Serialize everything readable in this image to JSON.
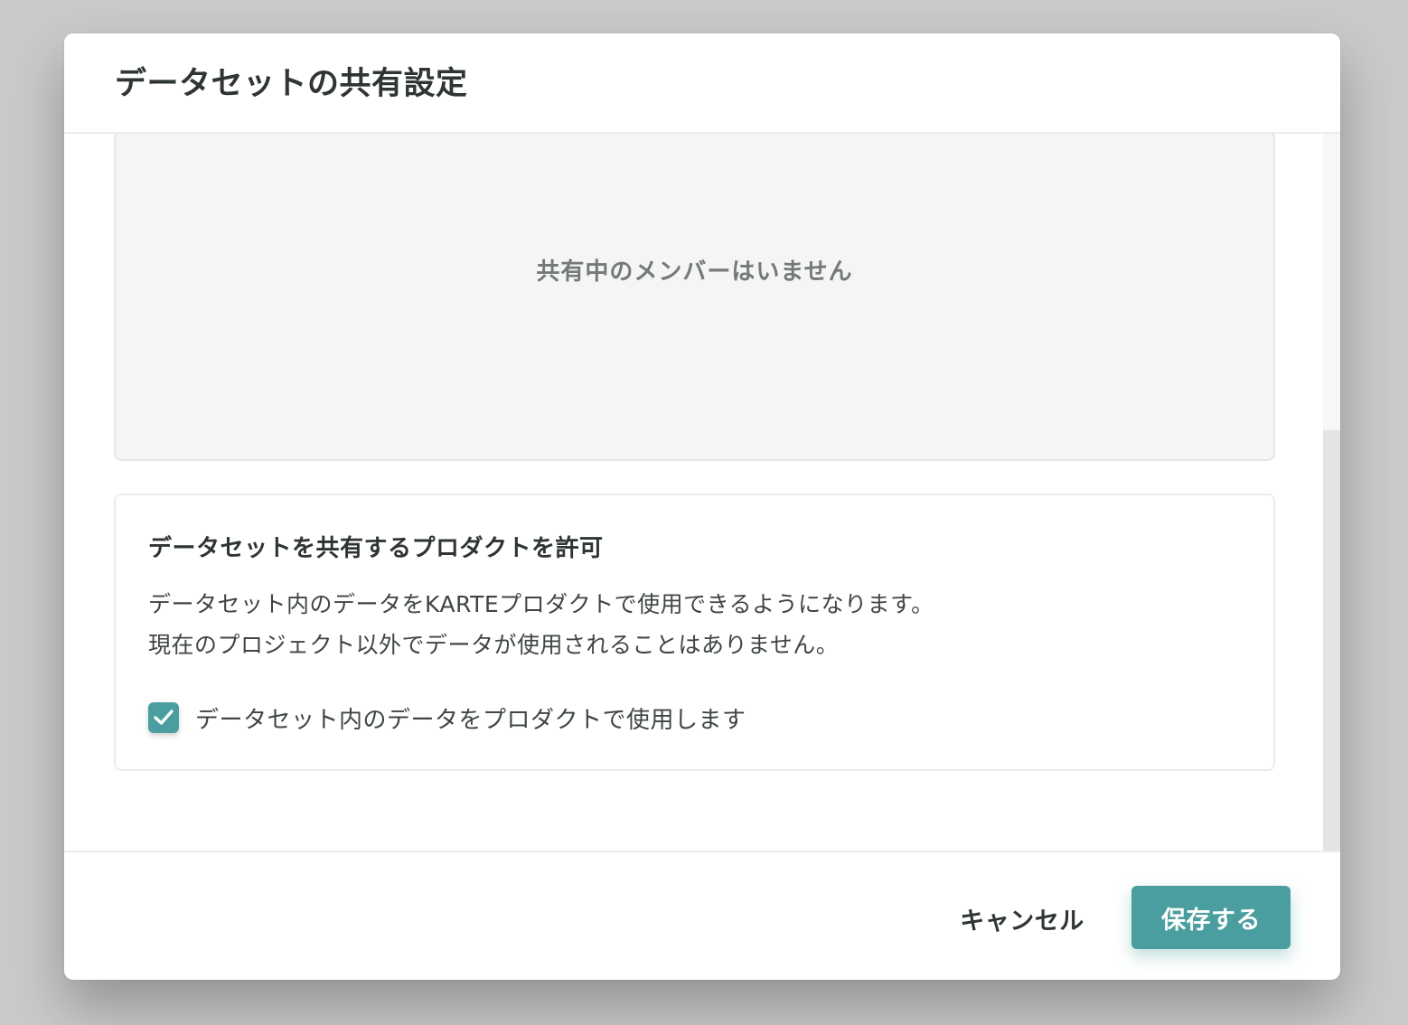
{
  "modal": {
    "title": "データセットの共有設定"
  },
  "members": {
    "empty_text": "共有中のメンバーはいません"
  },
  "permit": {
    "title": "データセットを共有するプロダクトを許可",
    "description_lines": [
      "データセット内のデータをKARTEプロダクトで使用できるようになります。",
      "現在のプロジェクト以外でデータが使用されることはありません。"
    ],
    "checkbox_label": "データセット内のデータをプロダクトで使用します",
    "checkbox_checked": true
  },
  "footer": {
    "cancel_label": "キャンセル",
    "save_label": "保存する"
  },
  "colors": {
    "accent": "#4a9e9f",
    "backdrop": "#c9cbca"
  }
}
